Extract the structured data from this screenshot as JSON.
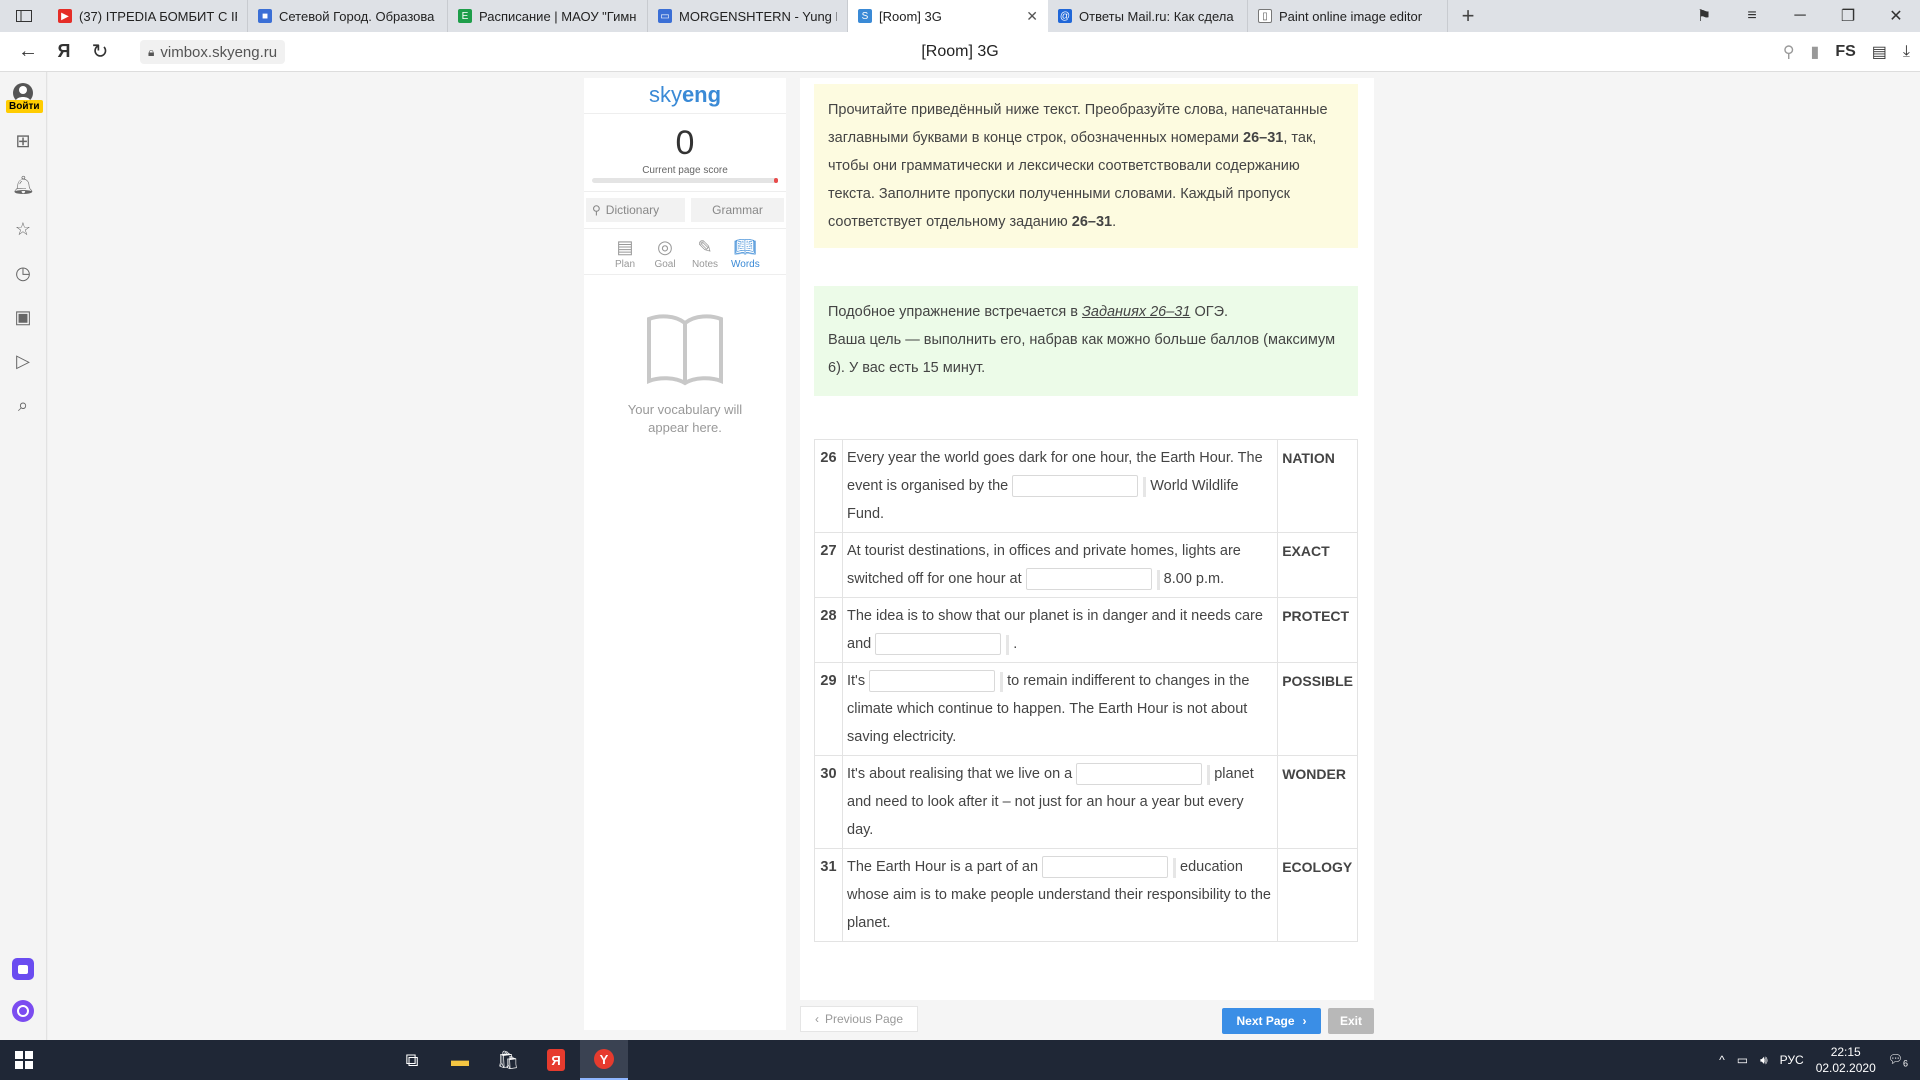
{
  "browser": {
    "tabs": [
      {
        "title": "(37) ITPEDIA БОМБИТ С IP",
        "fav_color": "#e52d27",
        "fav_glyph": "▶"
      },
      {
        "title": "Сетевой Город. Образова",
        "fav_color": "#3b6fd6",
        "fav_glyph": "■"
      },
      {
        "title": "Расписание | МАОУ \"Гимн",
        "fav_color": "#1e9e4a",
        "fav_glyph": "E"
      },
      {
        "title": "MORGENSHTERN - Yung H",
        "fav_color": "#3b6fd6",
        "fav_glyph": "▭"
      },
      {
        "title": "[Room] 3G",
        "fav_color": "#3a8ad6",
        "fav_glyph": "S"
      },
      {
        "title": "Ответы Mail.ru: Как сдела",
        "fav_color": "#2067d8",
        "fav_glyph": "@"
      },
      {
        "title": "Paint online image editor",
        "fav_color": "#ffffff",
        "fav_glyph": "▯"
      }
    ],
    "url": "vimbox.skyeng.ru",
    "page_title": "[Room] 3G",
    "login_label": "Войти"
  },
  "skyeng": {
    "logo_light": "sky",
    "logo_bold": "eng",
    "score": "0",
    "score_label": "Current page score",
    "dictionary_placeholder": "Dictionary",
    "grammar_label": "Grammar",
    "tools": [
      {
        "label": "Plan",
        "icon": "plan-icon"
      },
      {
        "label": "Goal",
        "icon": "goal-icon"
      },
      {
        "label": "Notes",
        "icon": "notes-icon"
      },
      {
        "label": "Words",
        "icon": "words-icon"
      }
    ],
    "vocab_line1": "Your vocabulary will",
    "vocab_line2": "appear here."
  },
  "instructions": {
    "yellow_p1": "Прочитайте приведённый ниже текст. Преобразуйте слова, напечатанные заглавными буквами в конце строк, обозначенных номерами ",
    "yellow_b1": "26–31",
    "yellow_p2": ", так, чтобы они грамматически и лексически соответствовали содержанию текста. Заполните пропуски полученными словами. Каждый пропуск соответствует отдельному заданию ",
    "yellow_b2": "26–31",
    "yellow_p3": ".",
    "green_p1": "Подобное упражнение встречается в ",
    "green_link": "Заданиях 26–31",
    "green_p2": " ОГЭ.",
    "green_p3": "Ваша цель — выполнить его, набрав как можно больше баллов (максимум 6). У вас есть 15 минут."
  },
  "tasks": [
    {
      "num": "26",
      "before": "Every year the world goes dark for one hour, the Earth Hour. The event is organised by the",
      "after": "World Wildlife Fund.",
      "word": "NATION"
    },
    {
      "num": "27",
      "before": "At tourist destinations, in offices and private homes, lights are switched off for one hour at",
      "after": "8.00 p.m.",
      "word": "EXACT"
    },
    {
      "num": "28",
      "before": "The idea is to show that our planet is in danger and it needs care and",
      "after": ".",
      "word": "PROTECT"
    },
    {
      "num": "29",
      "before": "It's",
      "after": "to remain indifferent to changes in the climate which continue to happen. The Earth Hour is not about saving electricity.",
      "word": "POSSIBLE"
    },
    {
      "num": "30",
      "before": "It's about realising that we live on a",
      "after": "planet and need to look after it – not just for an hour a year but every day.",
      "word": "WONDER"
    },
    {
      "num": "31",
      "before": "The Earth Hour is a part of an",
      "after": "education whose aim is to make people understand their responsibility to the planet.",
      "word": "ECOLOGY"
    }
  ],
  "footer": {
    "prev_label": "Previous Page",
    "next_label": "Next Page",
    "exit_label": "Exit"
  },
  "taskbar": {
    "lang": "РУС",
    "time": "22:15",
    "date": "02.02.2020",
    "notifications": "6"
  }
}
